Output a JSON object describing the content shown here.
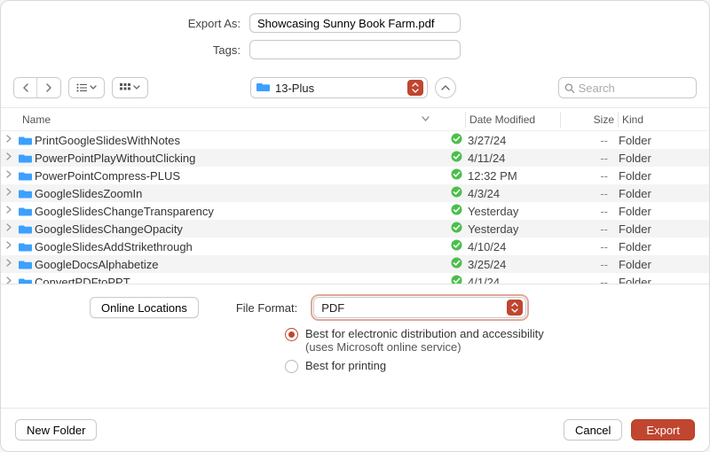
{
  "form": {
    "export_as_label": "Export As:",
    "export_as_value": "Showcasing Sunny Book Farm.pdf",
    "tags_label": "Tags:",
    "tags_value": ""
  },
  "toolbar": {
    "location_label": "13-Plus",
    "search_placeholder": "Search"
  },
  "columns": {
    "name": "Name",
    "date": "Date Modified",
    "size": "Size",
    "kind": "Kind"
  },
  "files": [
    {
      "name": "PrintGoogleSlidesWithNotes",
      "date": "3/27/24",
      "size": "--",
      "kind": "Folder"
    },
    {
      "name": "PowerPointPlayWithoutClicking",
      "date": "4/11/24",
      "size": "--",
      "kind": "Folder"
    },
    {
      "name": "PowerPointCompress-PLUS",
      "date": "12:32 PM",
      "size": "--",
      "kind": "Folder"
    },
    {
      "name": "GoogleSlidesZoomIn",
      "date": "4/3/24",
      "size": "--",
      "kind": "Folder"
    },
    {
      "name": "GoogleSlidesChangeTransparency",
      "date": "Yesterday",
      "size": "--",
      "kind": "Folder"
    },
    {
      "name": "GoogleSlidesChangeOpacity",
      "date": "Yesterday",
      "size": "--",
      "kind": "Folder"
    },
    {
      "name": "GoogleSlidesAddStrikethrough",
      "date": "4/10/24",
      "size": "--",
      "kind": "Folder"
    },
    {
      "name": "GoogleDocsAlphabetize",
      "date": "3/25/24",
      "size": "--",
      "kind": "Folder"
    },
    {
      "name": "ConvertPDFtoPPT",
      "date": "4/1/24",
      "size": "--",
      "kind": "Folder"
    }
  ],
  "lower": {
    "online_locations": "Online Locations",
    "file_format_label": "File Format:",
    "file_format_value": "PDF",
    "radio_best_electronic": "Best for electronic distribution and accessibility",
    "radio_best_electronic_sub": "(uses Microsoft online service)",
    "radio_best_printing": "Best for printing"
  },
  "footer": {
    "new_folder": "New Folder",
    "cancel": "Cancel",
    "export": "Export"
  },
  "colors": {
    "accent": "#c0462f",
    "folder_icon": "#1a8cff",
    "check_green": "#4bbf4b"
  }
}
